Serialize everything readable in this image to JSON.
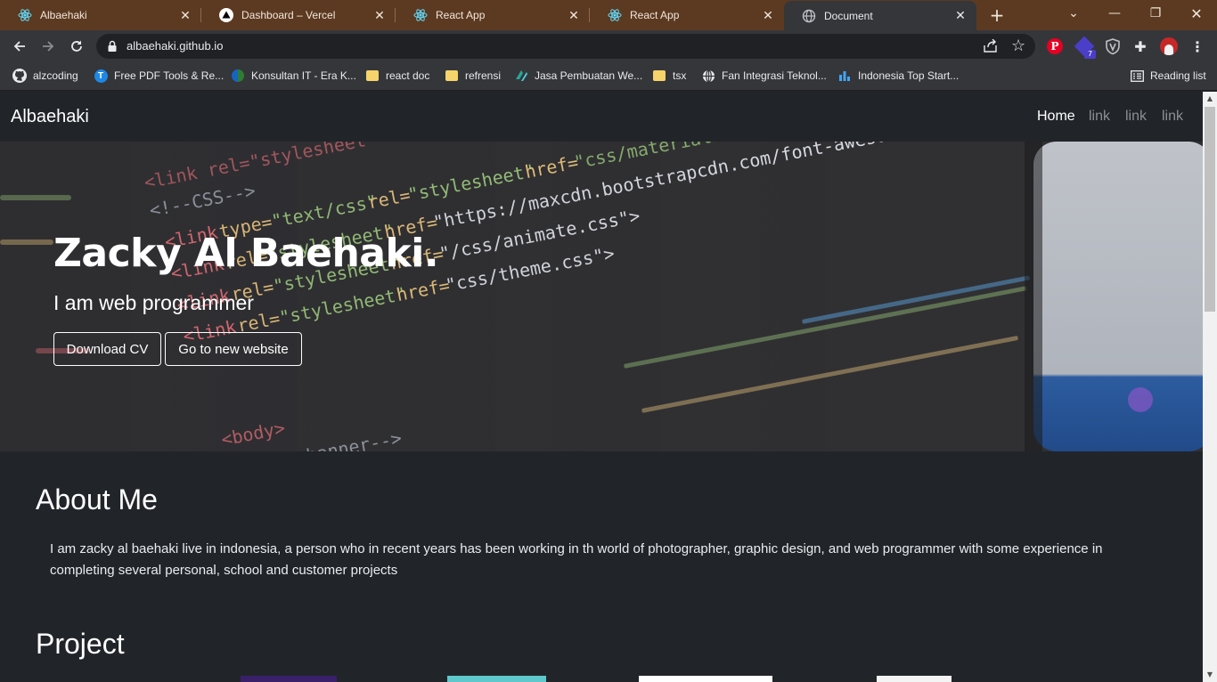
{
  "browser": {
    "tabs": [
      {
        "title": "Albaehaki",
        "icon": "react-icon"
      },
      {
        "title": "Dashboard – Vercel",
        "icon": "vercel-icon"
      },
      {
        "title": "React App",
        "icon": "react-icon"
      },
      {
        "title": "React App",
        "icon": "react-icon"
      },
      {
        "title": "Document",
        "icon": "globe-icon",
        "active": true
      }
    ],
    "new_tab": "+",
    "url": "albaehaki.github.io",
    "bookmarks": [
      {
        "label": "alzcoding",
        "icon": "github-icon"
      },
      {
        "label": "Free PDF Tools & Re...",
        "icon": "pdf-tools-icon"
      },
      {
        "label": "Konsultan IT - Era K...",
        "icon": "globe-icon"
      },
      {
        "label": "react doc",
        "icon": "folder-icon"
      },
      {
        "label": "refrensi",
        "icon": "folder-icon"
      },
      {
        "label": "Jasa Pembuatan We...",
        "icon": "site-icon"
      },
      {
        "label": "tsx",
        "icon": "folder-icon"
      },
      {
        "label": "Fan Integrasi Teknol...",
        "icon": "globe-icon"
      },
      {
        "label": "Indonesia Top Start...",
        "icon": "bar-chart-icon"
      }
    ],
    "reading_list": "Reading list",
    "extension_badge": "7"
  },
  "site": {
    "brand": "Albaehaki",
    "nav": [
      "Home",
      "link",
      "link",
      "link"
    ],
    "hero": {
      "title": "Zacky Al Baehaki.",
      "subtitle": "I am web programmer",
      "buttons": [
        "Download CV",
        "Go to new website"
      ]
    },
    "about": {
      "title": "About Me",
      "text": "I am zacky al baehaki live in indonesia, a person who in recent years has been working in th world of photographer, graphic design, and web programmer with some experience in completing several personal, school and customer projects"
    },
    "project": {
      "title": "Project"
    }
  },
  "colors": {
    "tabstrip": "#5c3a21",
    "toolbar": "#35363a",
    "page_bg": "#212529",
    "accent_pinterest": "#e60023"
  }
}
